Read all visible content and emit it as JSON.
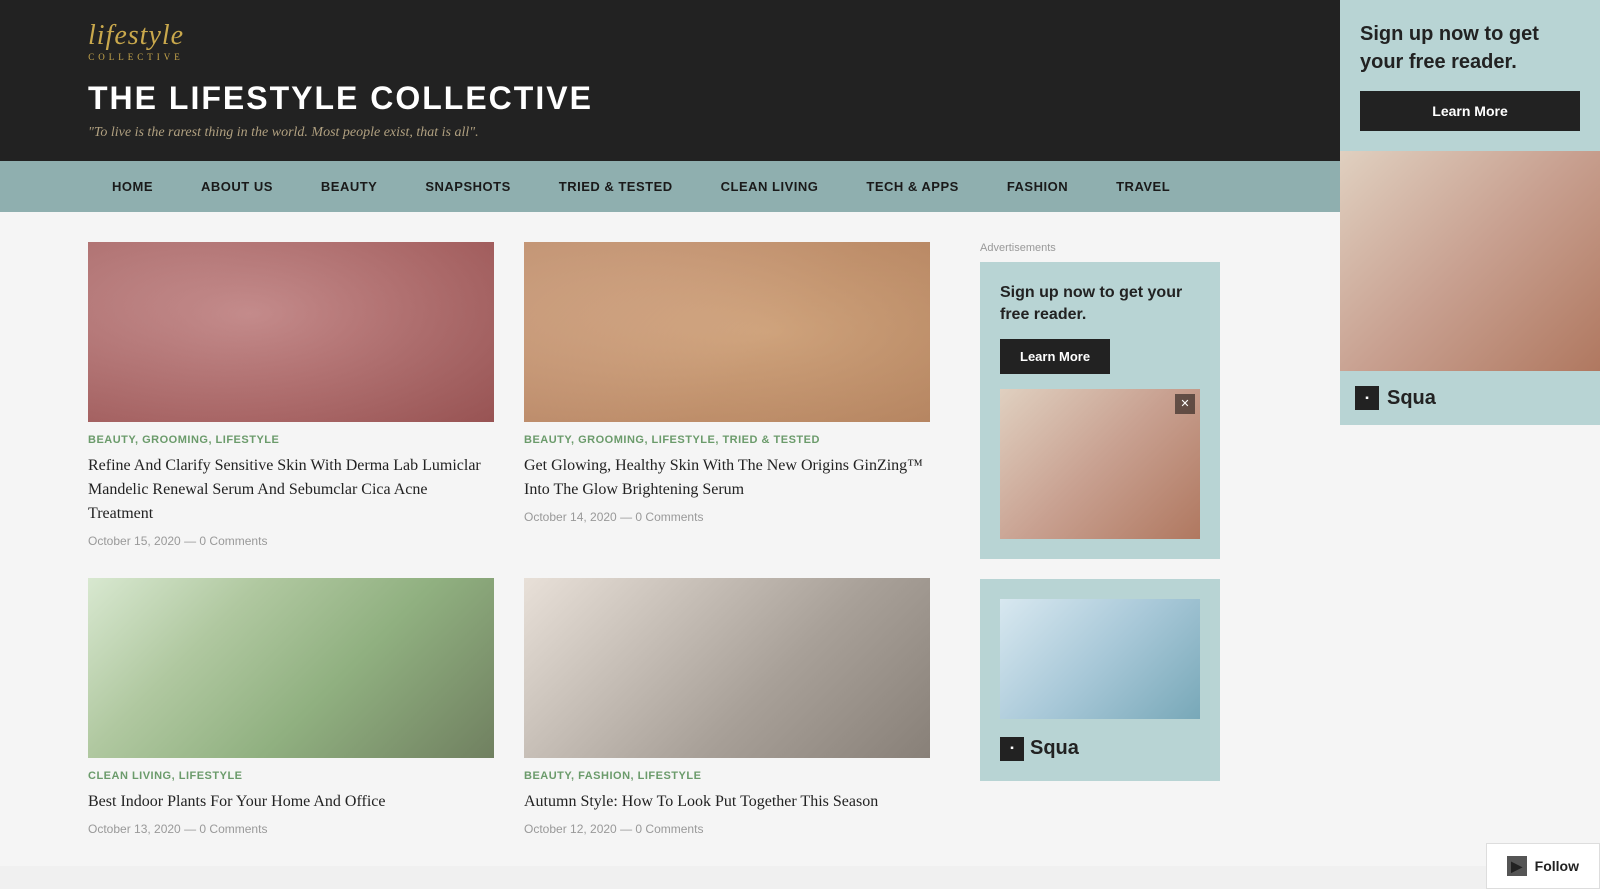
{
  "header": {
    "logo_text": "lifestyle",
    "logo_sub": "COLLECTIVE",
    "site_title": "THE LIFESTYLE COLLECTIVE",
    "site_tagline": "\"To live is the rarest thing in the world. Most people exist, that is all\"."
  },
  "nav": {
    "items": [
      {
        "label": "HOME",
        "href": "#"
      },
      {
        "label": "ABOUT US",
        "href": "#"
      },
      {
        "label": "BEAUTY",
        "href": "#"
      },
      {
        "label": "SNAPSHOTS",
        "href": "#"
      },
      {
        "label": "TRIED & TESTED",
        "href": "#"
      },
      {
        "label": "CLEAN LIVING",
        "href": "#"
      },
      {
        "label": "TECH & APPS",
        "href": "#"
      },
      {
        "label": "FASHION",
        "href": "#"
      },
      {
        "label": "TRAVEL",
        "href": "#"
      }
    ]
  },
  "articles": [
    {
      "categories": "BEAUTY, GROOMING, LIFESTYLE",
      "title": "Refine And Clarify Sensitive Skin With Derma Lab Lumiclar Mandelic Renewal Serum And Sebumclar Cica Acne Treatment",
      "date": "October 15, 2020",
      "comments": "0 Comments",
      "image_type": "skin"
    },
    {
      "categories": "BEAUTY, GROOMING, LIFESTYLE, TRIED & TESTED",
      "title": "Get Glowing, Healthy Skin With The New Origins GinZing™ Into The Glow Brightening Serum",
      "date": "October 14, 2020",
      "comments": "0 Comments",
      "image_type": "origins"
    },
    {
      "categories": "CLEAN LIVING, LIFESTYLE",
      "title": "Best Indoor Plants For Your Home And Office",
      "date": "October 13, 2020",
      "comments": "0 Comments",
      "image_type": "plant"
    },
    {
      "categories": "BEAUTY, FASHION, LIFESTYLE",
      "title": "Autumn Style: How To Look Put Together This Season",
      "date": "October 12, 2020",
      "comments": "0 Comments",
      "image_type": "woman"
    }
  ],
  "sidebar": {
    "ads_label": "Advertisements",
    "ad1": {
      "title": "Sign up now to get your free reader.",
      "btn_label": "Learn More"
    },
    "ad2": {
      "brand": "Squa"
    }
  },
  "right_panel": {
    "title": "Sign up now to get your free reader.",
    "btn_label": "Learn More"
  },
  "signup_bar": {
    "text": "Sign up now to get your free reader."
  },
  "follow_btn": {
    "label": "Follow"
  }
}
